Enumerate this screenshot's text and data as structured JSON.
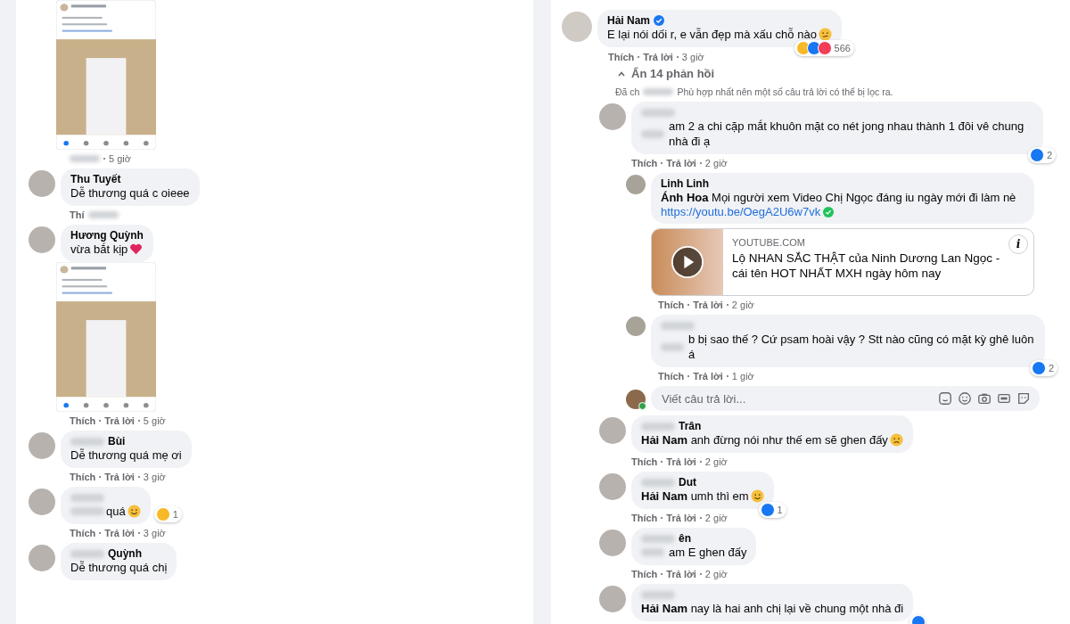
{
  "left": {
    "items": [
      {
        "kind": "screenshot",
        "meta": {
          "hidden_prefix": true,
          "time": "5 giờ"
        }
      },
      {
        "kind": "comment",
        "name": "Thu Tuyết",
        "text": "Dễ thương quá c oieee",
        "meta": {
          "like": "Thí",
          "hidden_suffix": true
        }
      },
      {
        "kind": "comment",
        "name": "Hương Quỳnh",
        "text": "vừa bắt kịp",
        "emoji": {
          "kind": "heart"
        }
      },
      {
        "kind": "screenshot",
        "meta": {
          "like": "Thích",
          "reply": "Trả lời",
          "time": "5 giờ"
        }
      },
      {
        "kind": "comment",
        "hidden_name": true,
        "name": "Bùi",
        "text": "Dễ thương quá mẹ ơi",
        "meta": {
          "like": "Thích",
          "reply": "Trả lời",
          "time": "3 giờ"
        }
      },
      {
        "kind": "comment",
        "hidden_name": true,
        "hidden_text": true,
        "text": "quá",
        "emoji": {
          "kind": "smile"
        },
        "reactions": {
          "types": [
            {
              "kind": "haha"
            }
          ],
          "count": "1"
        },
        "meta": {
          "like": "Thích",
          "reply": "Trả lời",
          "time": "3 giờ"
        }
      },
      {
        "kind": "comment",
        "hidden_name": true,
        "name": "Quỳnh",
        "text": "Dễ thương quá chị"
      }
    ]
  },
  "right": {
    "comment": {
      "name": "Hải Nam",
      "verified": true,
      "text": "E lại nói dối r, e vẫn đẹp mà xấu chỗ nào",
      "emoji": {
        "kind": "thinking"
      },
      "reactions": {
        "types": [
          {
            "kind": "haha"
          },
          {
            "kind": "like"
          },
          {
            "kind": "love"
          }
        ],
        "count": "566"
      },
      "meta": {
        "like": "Thích",
        "reply": "Trả lời",
        "time": "3 giờ"
      }
    },
    "toggle": "Ẩn 14 phản hồi",
    "notice": {
      "start": "Đã ch",
      "end": "Phù hợp nhất nên một số câu trả lời có thể bị lọc ra."
    },
    "replies": [
      {
        "hidden_name": true,
        "hidden_text": true,
        "text": "am 2 a chi cặp mắt khuôn mặt co nét jong nhau thành 1 đôi vê chung nhà đi ạ",
        "reactions": {
          "types": [
            {
              "kind": "like"
            }
          ],
          "count": "2"
        },
        "meta": {
          "like": "Thích",
          "reply": "Trả lời",
          "time": "2 giờ"
        },
        "children": [
          {
            "name": "Linh Linh",
            "text": "**Ánh Hoa** Mọi người xem Video Chị Ngọc đáng iu ngày mới đi làm nè",
            "link": "https://youtu.be/OegA2U6w7vk",
            "preview": {
              "domain": "YOUTUBE.COM",
              "title": "Lộ NHAN SẮC THẬT của Ninh Dương Lan Ngọc - cái tên HOT NHẤT MXH ngày hôm nay",
              "info": "i"
            },
            "meta": {
              "like": "Thích",
              "reply": "Trả lời",
              "time": "2 giờ"
            }
          },
          {
            "hidden_name": true,
            "hidden_text": true,
            "text": "b bị sao thế ? Cứ psam hoài vậy ? Stt nào cũng có mặt kỳ ghê luôn á",
            "reactions": {
              "types": [
                {
                  "kind": "like"
                }
              ],
              "count": "2"
            },
            "meta": {
              "like": "Thích",
              "reply": "Trả lời",
              "time": "1 giờ"
            }
          }
        ],
        "reply_box": {
          "placeholder": "Viết câu trả lời..."
        }
      },
      {
        "hidden_name": true,
        "name": "Trân",
        "text": "**Hải Nam** anh đừng nói như thế em sẽ ghen đấy",
        "emoji": {
          "kind": "cry"
        },
        "meta": {
          "like": "Thích",
          "reply": "Trả lời",
          "time": "2 giờ"
        }
      },
      {
        "hidden_name": true,
        "name": "Dut",
        "text": "**Hải Nam** umh thì em",
        "emoji": {
          "kind": "grin"
        },
        "reactions": {
          "types": [
            {
              "kind": "like"
            }
          ],
          "count": "1"
        },
        "meta": {
          "like": "Thích",
          "reply": "Trả lời",
          "time": "2 giờ"
        }
      },
      {
        "hidden_name": true,
        "name": "ên",
        "hidden_text": true,
        "text": "am E ghen đấy",
        "meta": {
          "like": "Thích",
          "reply": "Trả lời",
          "time": "2 giờ"
        }
      },
      {
        "hidden_name": true,
        "text": "**Hải Nam** nay là hai anh chị lại về chung một nhà đi",
        "reactions": {
          "types": [
            {
              "kind": "like"
            }
          ]
        }
      }
    ]
  }
}
